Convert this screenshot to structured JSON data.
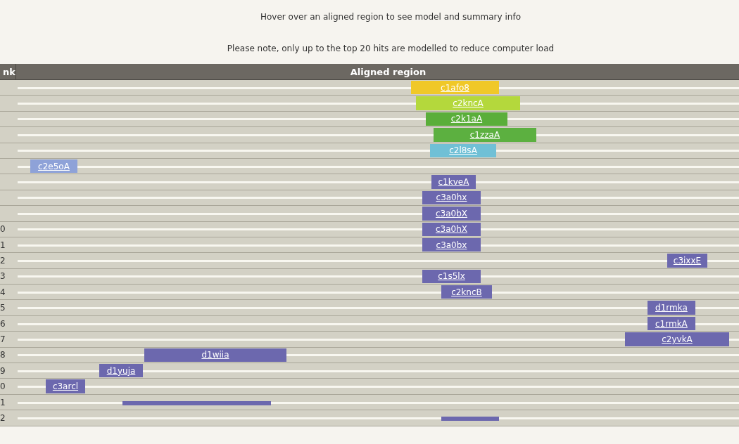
{
  "notes": [
    "Hover over an aligned region to see model and summary info",
    "Please note, only up to the top 20 hits are modelled to reduce computer load"
  ],
  "table": {
    "columns": [
      "nk",
      "Aligned region"
    ],
    "rows": [
      {
        "kind": "bar",
        "label": "c1afo8",
        "color": "#f0c828"
      },
      {
        "kind": "bar",
        "label": "c2kncA",
        "color": "#b4d83c"
      },
      {
        "kind": "bar",
        "label": "c2k1aA",
        "color": "#5aae3a"
      },
      {
        "kind": "bar",
        "label": "c1zzaA",
        "color": "#5cb040"
      },
      {
        "kind": "bar",
        "label": "c2l8sA",
        "color": "#70c0d6"
      },
      {
        "kind": "bar",
        "label": "c2e5oA",
        "color": "#8ea2d8"
      },
      {
        "kind": "bar",
        "label": "c1kveA",
        "color": "#6c68ae"
      },
      {
        "kind": "bar",
        "label": "c3a0hx",
        "color": "#6c68ae"
      },
      {
        "kind": "bar",
        "label": "c3a0bX",
        "color": "#6c68ae"
      },
      {
        "rank": "0",
        "kind": "bar",
        "label": "c3a0hX",
        "color": "#6c68ae"
      },
      {
        "rank": "1",
        "kind": "bar",
        "label": "c3a0bx",
        "color": "#6c68ae"
      },
      {
        "rank": "2",
        "kind": "bar",
        "label": "c3ixxE",
        "color": "#6c68ae"
      },
      {
        "rank": "3",
        "kind": "bar",
        "label": "c1s5lx",
        "color": "#6c68ae"
      },
      {
        "rank": "4",
        "kind": "bar",
        "label": "c2kncB",
        "color": "#6c68ae"
      },
      {
        "rank": "5",
        "kind": "bar",
        "label": "d1rmka",
        "color": "#6c68ae"
      },
      {
        "rank": "6",
        "kind": "bar",
        "label": "c1rmkA",
        "color": "#6c68ae"
      },
      {
        "rank": "7",
        "kind": "bar",
        "label": "c2yvkA",
        "color": "#6c68ae"
      },
      {
        "rank": "8",
        "kind": "bar",
        "label": "d1wiia",
        "color": "#6c68ae"
      },
      {
        "rank": "9",
        "kind": "bar",
        "label": "d1yuja",
        "color": "#6c68ae"
      },
      {
        "rank": "0",
        "kind": "bar",
        "label": "c3arcl",
        "color": "#6c68ae"
      },
      {
        "rank": "1",
        "kind": "line",
        "color": "#6c68ae"
      },
      {
        "rank": "2",
        "kind": "line",
        "color": "#6c68ae"
      }
    ]
  }
}
